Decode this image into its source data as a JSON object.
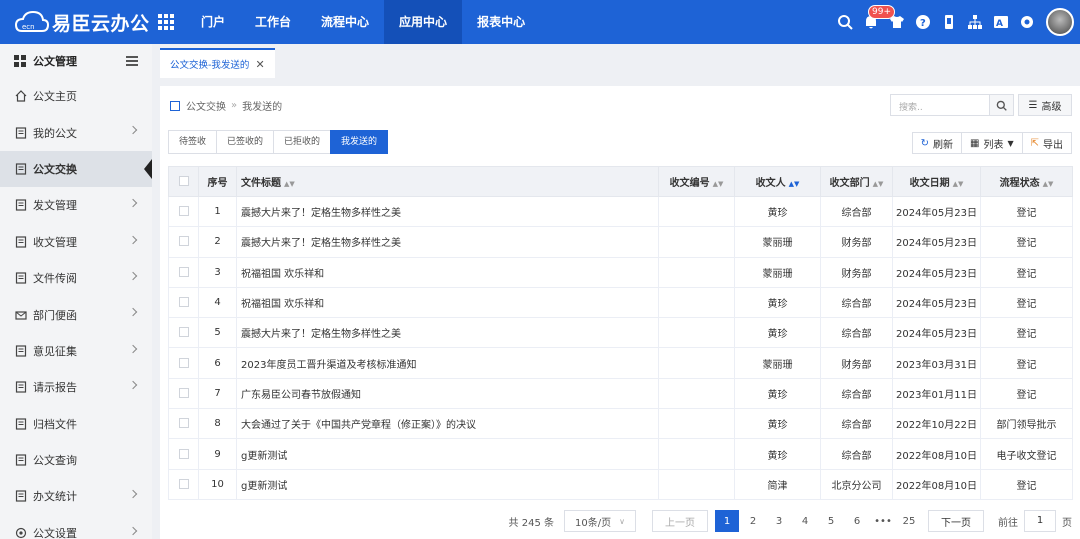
{
  "app": {
    "title": "易臣云办公",
    "logo_mark": "cloud"
  },
  "nav": [
    "门户",
    "工作台",
    "流程中心",
    "应用中心",
    "报表中心"
  ],
  "nav_active": 3,
  "notifications": {
    "badge": "99+"
  },
  "sidebar": {
    "header": "公文管理",
    "items": [
      {
        "label": "公文主页",
        "icon": "home-icon",
        "chevron": false
      },
      {
        "label": "我的公文",
        "icon": "document-icon",
        "chevron": true
      },
      {
        "label": "公文交换",
        "icon": "exchange-icon",
        "chevron": false,
        "active": true
      },
      {
        "label": "发文管理",
        "icon": "send-doc-icon",
        "chevron": true
      },
      {
        "label": "收文管理",
        "icon": "receive-doc-icon",
        "chevron": true
      },
      {
        "label": "文件传阅",
        "icon": "circulate-icon",
        "chevron": true
      },
      {
        "label": "部门便函",
        "icon": "mail-icon",
        "chevron": true
      },
      {
        "label": "意见征集",
        "icon": "opinion-icon",
        "chevron": true
      },
      {
        "label": "请示报告",
        "icon": "report-icon",
        "chevron": true
      },
      {
        "label": "归档文件",
        "icon": "archive-icon",
        "chevron": false
      },
      {
        "label": "公文查询",
        "icon": "query-icon",
        "chevron": false
      },
      {
        "label": "办文统计",
        "icon": "stats-icon",
        "chevron": true
      },
      {
        "label": "公文设置",
        "icon": "settings-icon",
        "chevron": true
      }
    ]
  },
  "page_tab": {
    "label": "公文交换-我发送的",
    "close": "✕"
  },
  "breadcrumb": {
    "root": "公文交换",
    "sep": "»",
    "current": "我发送的"
  },
  "search": {
    "placeholder": "搜索.."
  },
  "advanced": "高级",
  "subtabs": [
    "待签收",
    "已签收的",
    "已拒收的",
    "我发送的"
  ],
  "subtab_active": 3,
  "tools": {
    "refresh": "刷新",
    "list": "列表",
    "export": "导出"
  },
  "table": {
    "columns": [
      "序号",
      "文件标题",
      "收文编号",
      "收文人",
      "收文部门",
      "收文日期",
      "流程状态"
    ],
    "rows": [
      {
        "no": "1",
        "title": "震撼大片来了！定格生物多样性之美",
        "code": "",
        "recipient": "黄珍",
        "dept": "综合部",
        "date": "2024年05月23日",
        "status": "登记"
      },
      {
        "no": "2",
        "title": "震撼大片来了！定格生物多样性之美",
        "code": "",
        "recipient": "蒙丽珊",
        "dept": "财务部",
        "date": "2024年05月23日",
        "status": "登记"
      },
      {
        "no": "3",
        "title": "祝福祖国 欢乐祥和",
        "code": "",
        "recipient": "蒙丽珊",
        "dept": "财务部",
        "date": "2024年05月23日",
        "status": "登记"
      },
      {
        "no": "4",
        "title": "祝福祖国 欢乐祥和",
        "code": "",
        "recipient": "黄珍",
        "dept": "综合部",
        "date": "2024年05月23日",
        "status": "登记"
      },
      {
        "no": "5",
        "title": "震撼大片来了！定格生物多样性之美",
        "code": "",
        "recipient": "黄珍",
        "dept": "综合部",
        "date": "2024年05月23日",
        "status": "登记"
      },
      {
        "no": "6",
        "title": "2023年度员工晋升渠道及考核标准通知",
        "code": "",
        "recipient": "蒙丽珊",
        "dept": "财务部",
        "date": "2023年03月31日",
        "status": "登记"
      },
      {
        "no": "7",
        "title": "广东易臣公司春节放假通知",
        "code": "",
        "recipient": "黄珍",
        "dept": "综合部",
        "date": "2023年01月11日",
        "status": "登记"
      },
      {
        "no": "8",
        "title": "大会通过了关于《中国共产党章程（修正案）》的决议",
        "code": "",
        "recipient": "黄珍",
        "dept": "综合部",
        "date": "2022年10月22日",
        "status": "部门领导批示"
      },
      {
        "no": "9",
        "title": "g更新测试",
        "code": "",
        "recipient": "黄珍",
        "dept": "综合部",
        "date": "2022年08月10日",
        "status": "电子收文登记"
      },
      {
        "no": "10",
        "title": "g更新测试",
        "code": "",
        "recipient": "简津",
        "dept": "北京分公司",
        "date": "2022年08月10日",
        "status": "登记"
      }
    ]
  },
  "pagination": {
    "total": "共 245 条",
    "page_size": "10条/页",
    "prev": "上一页",
    "pages": [
      "1",
      "2",
      "3",
      "4",
      "5",
      "6",
      "•••",
      "25"
    ],
    "current": "1",
    "next": "下一页",
    "goto_label": "前往",
    "goto_value": "1",
    "goto_unit": "页"
  }
}
